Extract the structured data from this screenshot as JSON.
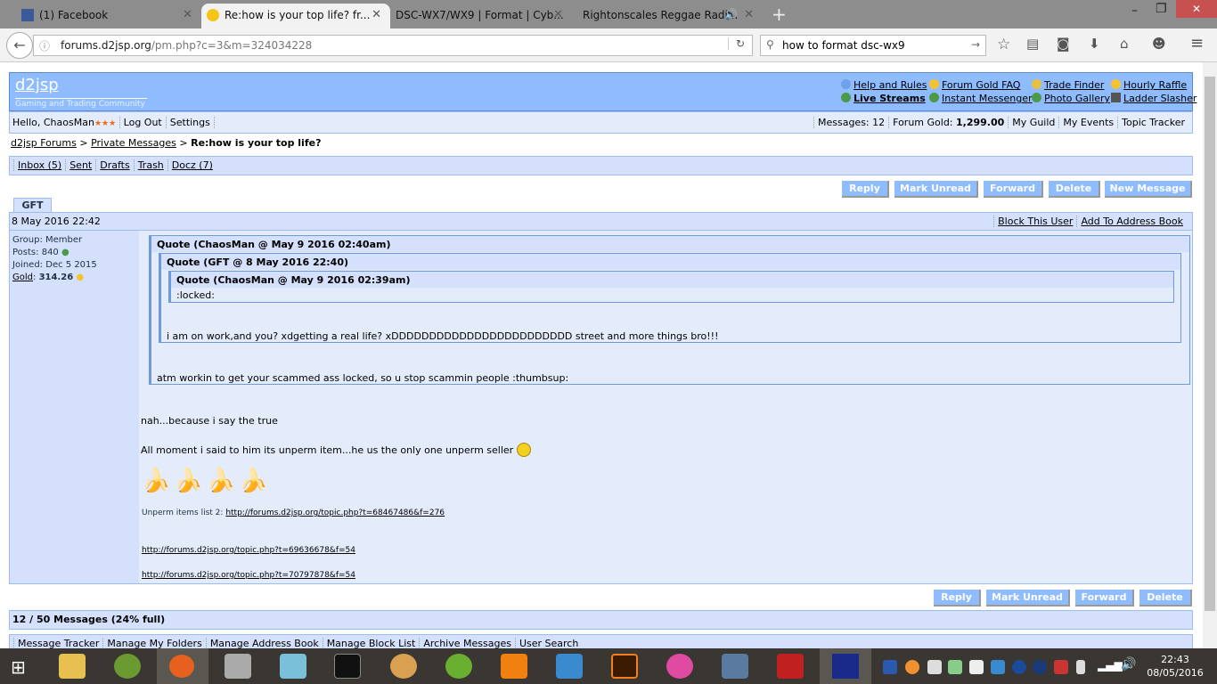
{
  "browser": {
    "tabs": [
      {
        "title": "(1) Facebook",
        "active": false
      },
      {
        "title": "Re:how is your top life? fr...",
        "active": true
      },
      {
        "title": "DSC-WX7/WX9 | Format | Cyb...",
        "active": false
      },
      {
        "title": "Rightonscales Reggae Radi...",
        "active": false,
        "audio": true
      }
    ],
    "url_domain": "forums.d2jsp.org",
    "url_path": "/pm.php?c=3&m=324034228",
    "search_value": "how to format dsc-wx9"
  },
  "header": {
    "logo": "d2jsp",
    "tagline": "Gaming and Trading Community",
    "links": [
      {
        "label": "Help and Rules",
        "icon": "help-icon"
      },
      {
        "label": "Forum Gold FAQ",
        "icon": "gold-icon"
      },
      {
        "label": "Trade Finder",
        "icon": "search-icon"
      },
      {
        "label": "Hourly Raffle",
        "icon": "gold-icon"
      },
      {
        "label": "Live Streams",
        "icon": "users-icon",
        "bold": true
      },
      {
        "label": "Instant Messenger",
        "icon": "users-icon"
      },
      {
        "label": "Photo Gallery",
        "icon": "users-icon"
      },
      {
        "label": "Ladder Slasher",
        "icon": "sword-icon"
      }
    ]
  },
  "userbar": {
    "hello": "Hello, ChaosMan",
    "stars": "★★★",
    "logout": "Log Out",
    "settings": "Settings",
    "messages": "Messages: 12",
    "gold_label": "Forum Gold:",
    "gold_value": "1,299.00",
    "guild": "My Guild",
    "events": "My Events",
    "tracker": "Topic Tracker"
  },
  "breadcrumb": {
    "root": "d2jsp Forums",
    "sep": ">",
    "pm": "Private Messages",
    "current": "Re:how is your top life?"
  },
  "folders": [
    "Inbox (5)",
    "Sent",
    "Drafts",
    "Trash",
    "Docz (7)"
  ],
  "actions": {
    "reply": "Reply",
    "mark_unread": "Mark Unread",
    "forward": "Forward",
    "delete": "Delete",
    "new_message": "New Message"
  },
  "message": {
    "sender_tab": "GFT",
    "date": "8 May 2016 22:42",
    "block": "Block This User",
    "addbook": "Add To Address Book",
    "profile": {
      "group_label": "Group:",
      "group": "Member",
      "posts_label": "Posts:",
      "posts": "840",
      "joined_label": "Joined:",
      "joined": "Dec 5 2015",
      "gold_label": "Gold",
      "gold": "314.26"
    },
    "quote1_head": "Quote (ChaosMan @ May 9 2016 02:40am)",
    "quote2_head": "Quote (GFT @ 8 May 2016 22:40)",
    "quote3_head": "Quote (ChaosMan @ May 9 2016 02:39am)",
    "quote3_text": ":locked:",
    "quote2_text": "i am on work,and you? xdgetting a real life? xDDDDDDDDDDDDDDDDDDDDDDDD street and more things bro!!!",
    "quote1_text": "atm workin to get your scammed ass locked, so u stop scammin people :thumbsup:",
    "line1": "nah...because i say the true",
    "line2": "All moment i said to him its unperm item...he us the only one unperm seller",
    "sig_label": "Unperm items list 2:",
    "sig_link1": "http://forums.d2jsp.org/topic.php?t=68467486&f=276",
    "link2": "http://forums.d2jsp.org/topic.php?t=69636678&f=54",
    "link3": "http://forums.d2jsp.org/topic.php?t=70797878&f=54"
  },
  "footer": {
    "count": "12 / 50 Messages (24% full)",
    "links": [
      "Message Tracker",
      "Manage My Folders",
      "Manage Address Book",
      "Manage Block List",
      "Archive Messages",
      "User Search"
    ]
  },
  "taskbar": {
    "time": "22:43",
    "date": "08/05/2016"
  }
}
